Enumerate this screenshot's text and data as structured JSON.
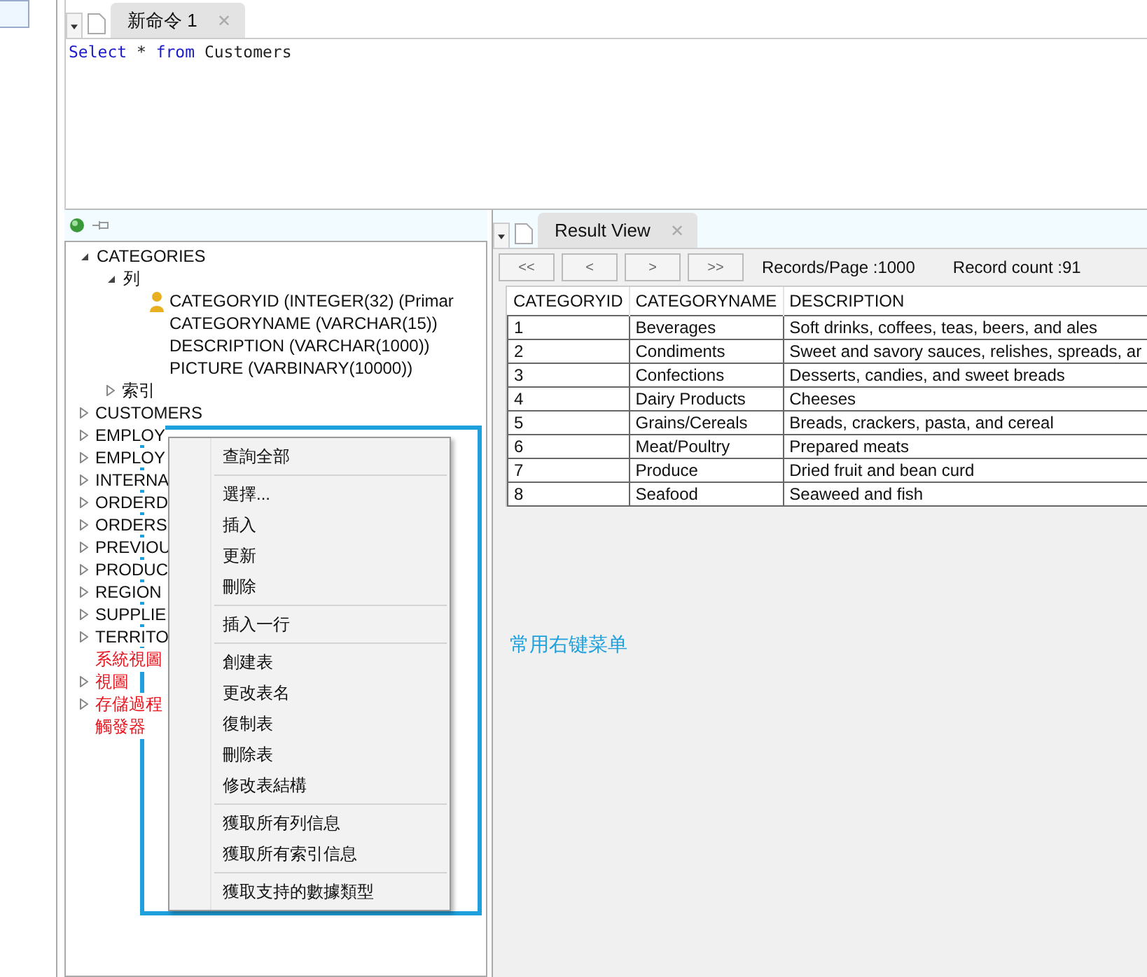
{
  "editor": {
    "tabs": [
      {
        "label": "新命令 1",
        "selected": true
      }
    ],
    "close_glyph": "✕",
    "sql": [
      {
        "kind": "keyword",
        "text": "Select"
      },
      {
        "kind": "plain",
        "text": " * "
      },
      {
        "kind": "keyword",
        "text": "from"
      },
      {
        "kind": "plain",
        "text": " Customers"
      }
    ]
  },
  "tree": {
    "items": [
      {
        "label": "CATEGORIES",
        "expanded": true,
        "children": [
          {
            "label": "列",
            "expanded": true,
            "children": [
              {
                "label": "CATEGORYID  (INTEGER(32)  (Primar",
                "primary_key": true
              },
              {
                "label": "CATEGORYNAME  (VARCHAR(15))"
              },
              {
                "label": "DESCRIPTION  (VARCHAR(1000))"
              },
              {
                "label": "PICTURE  (VARBINARY(10000))"
              }
            ]
          },
          {
            "label": "索引",
            "expanded": false
          }
        ]
      },
      {
        "label": "CUSTOMERS",
        "expanded": false
      },
      {
        "label": "EMPLOY",
        "expanded": false
      },
      {
        "label": "EMPLOY",
        "expanded": false
      },
      {
        "label": "INTERNA",
        "expanded": false
      },
      {
        "label": "ORDERD",
        "expanded": false
      },
      {
        "label": "ORDERS",
        "expanded": false
      },
      {
        "label": "PREVIOU",
        "expanded": false
      },
      {
        "label": "PRODUC",
        "expanded": false
      },
      {
        "label": "REGION",
        "expanded": false
      },
      {
        "label": "SUPPLIE",
        "expanded": false
      },
      {
        "label": "TERRITO",
        "expanded": false
      },
      {
        "label": "系統視圖",
        "color": "#e8141e"
      },
      {
        "label": "視圖",
        "expanded": false,
        "color": "#e8141e"
      },
      {
        "label": "存儲過程",
        "expanded": false,
        "color": "#e8141e"
      },
      {
        "label": "觸發器",
        "color": "#e8141e"
      }
    ]
  },
  "context_menu": {
    "groups": [
      [
        "查詢全部"
      ],
      [
        "選擇...",
        "插入",
        "更新",
        "刪除"
      ],
      [
        "插入一行"
      ],
      [
        "創建表",
        "更改表名",
        "復制表",
        "刪除表",
        "修改表結構"
      ],
      [
        "獲取所有列信息",
        "獲取所有索引信息"
      ],
      [
        "獲取支持的數據類型"
      ]
    ]
  },
  "annotation": {
    "label": "常用右键菜单"
  },
  "result": {
    "tabs": [
      {
        "label": "Result View",
        "selected": true
      }
    ],
    "close_glyph": "✕",
    "pager": [
      "<<",
      "<",
      ">",
      ">>"
    ],
    "records_per_page": "Records/Page :1000",
    "record_count": "Record count :91",
    "table": {
      "columns": [
        "CATEGORYID",
        "CATEGORYNAME",
        "DESCRIPTION"
      ],
      "rows": [
        [
          "1",
          "Beverages",
          "Soft drinks, coffees, teas, beers, and ales"
        ],
        [
          "2",
          "Condiments",
          "Sweet and savory sauces, relishes, spreads, ar"
        ],
        [
          "3",
          "Confections",
          "Desserts, candies, and sweet breads"
        ],
        [
          "4",
          "Dairy Products",
          "Cheeses"
        ],
        [
          "5",
          "Grains/Cereals",
          "Breads, crackers, pasta, and cereal"
        ],
        [
          "6",
          "Meat/Poultry",
          "Prepared meats"
        ],
        [
          "7",
          "Produce",
          "Dried fruit and bean curd"
        ],
        [
          "8",
          "Seafood",
          "Seaweed and fish"
        ]
      ]
    }
  }
}
